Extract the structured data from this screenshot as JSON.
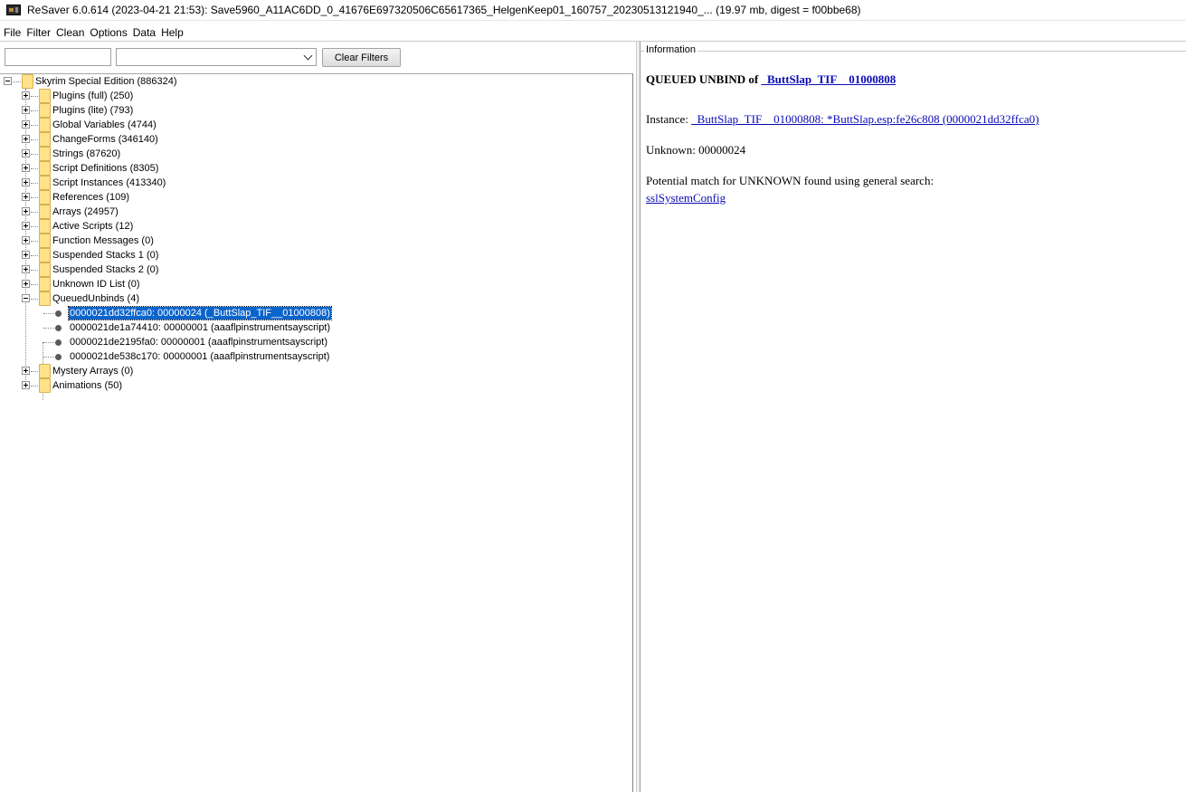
{
  "window": {
    "title": "ReSaver 6.0.614 (2023-04-21 21:53): Save5960_A11AC6DD_0_41676E697320506C65617365_HelgenKeep01_160757_20230513121940_... (19.97 mb, digest = f00bbe68)",
    "icon": "app-icon"
  },
  "menu": [
    "File",
    "Filter",
    "Clean",
    "Options",
    "Data",
    "Help"
  ],
  "filter": {
    "text_value": "",
    "select_value": "",
    "clear_label": "Clear Filters"
  },
  "tree": {
    "root": "Skyrim Special Edition (886324)",
    "nodes": [
      {
        "label": "Plugins (full) (250)",
        "expanded": false
      },
      {
        "label": "Plugins (lite) (793)",
        "expanded": false
      },
      {
        "label": "Global Variables (4744)",
        "expanded": false
      },
      {
        "label": "ChangeForms (346140)",
        "expanded": false
      },
      {
        "label": "Strings (87620)",
        "expanded": false
      },
      {
        "label": "Script Definitions (8305)",
        "expanded": false
      },
      {
        "label": "Script Instances (413340)",
        "expanded": false
      },
      {
        "label": "References (109)",
        "expanded": false
      },
      {
        "label": "Arrays (24957)",
        "expanded": false
      },
      {
        "label": "Active Scripts (12)",
        "expanded": false
      },
      {
        "label": "Function Messages (0)",
        "expanded": false
      },
      {
        "label": "Suspended Stacks 1 (0)",
        "expanded": false
      },
      {
        "label": "Suspended Stacks 2 (0)",
        "expanded": false
      },
      {
        "label": "Unknown ID List (0)",
        "expanded": false
      },
      {
        "label": "QueuedUnbinds (4)",
        "expanded": true
      },
      {
        "label": "Mystery Arrays (0)",
        "expanded": false
      },
      {
        "label": "Animations (50)",
        "expanded": false
      }
    ],
    "queued_unbinds": [
      {
        "label": "0000021dd32ffca0: 00000024 (_ButtSlap_TIF__01000808)",
        "selected": true
      },
      {
        "label": "0000021de1a74410: 00000001 (aaaflpinstrumentsayscript)",
        "selected": false
      },
      {
        "label": "0000021de2195fa0: 00000001 (aaaflpinstrumentsayscript)",
        "selected": false
      },
      {
        "label": "0000021de538c170: 00000001 (aaaflpinstrumentsayscript)",
        "selected": false
      }
    ]
  },
  "info": {
    "legend": "Information",
    "heading_prefix": "QUEUED UNBIND of ",
    "heading_link": "_ButtSlap_TIF__01000808",
    "instance_prefix": "Instance: ",
    "instance_link": "_ButtSlap_TIF__01000808: *ButtSlap.esp:fe26c808 (0000021dd32ffca0)",
    "unknown_line": "Unknown: 00000024",
    "potential_line": "Potential match for UNKNOWN found using general search:",
    "potential_link": "sslSystemConfig",
    "link_color": "#0b0bb8"
  },
  "colors": {
    "selection": "#0a64cc",
    "folder": "#ffe28a"
  }
}
